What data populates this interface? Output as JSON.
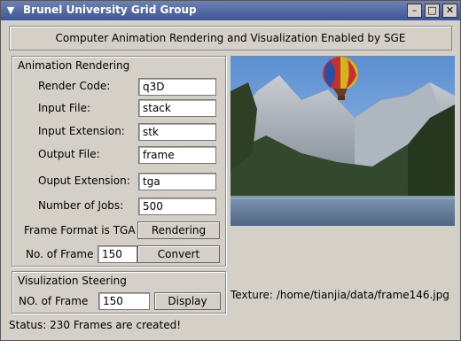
{
  "window": {
    "title": "Brunel University Grid Group",
    "menu_icon": "chevron-down-icon",
    "controls": [
      "close-icon",
      "maximize-icon",
      "minimize-icon"
    ]
  },
  "header": {
    "text": "Computer Animation Rendering and Visualization Enabled by SGE"
  },
  "rendering": {
    "group_title": "Animation Rendering",
    "fields": [
      {
        "label": "Render Code:",
        "value": "q3D"
      },
      {
        "label": "Input File:",
        "value": "stack"
      },
      {
        "label": "Input Extension:",
        "value": "stk"
      },
      {
        "label": "Output File:",
        "value": "frame"
      },
      {
        "label": "Ouput Extension:",
        "value": "tga"
      },
      {
        "label": "Number of Jobs:",
        "value": "500"
      }
    ],
    "format_label": "Frame Format is TGA",
    "rendering_button": "Rendering",
    "frames_label": "No. of Frame",
    "frames_value": "150",
    "convert_button": "Convert"
  },
  "visualization": {
    "group_title": "Visulization Steering",
    "frames_label": "NO. of Frame",
    "frames_value": "150",
    "display_button": "Display"
  },
  "preview": {
    "texture_label": "Texture:",
    "texture_path": "/home/tianjia/data/frame146.jpg"
  },
  "status": {
    "text": "Status: 230  Frames are created!"
  }
}
